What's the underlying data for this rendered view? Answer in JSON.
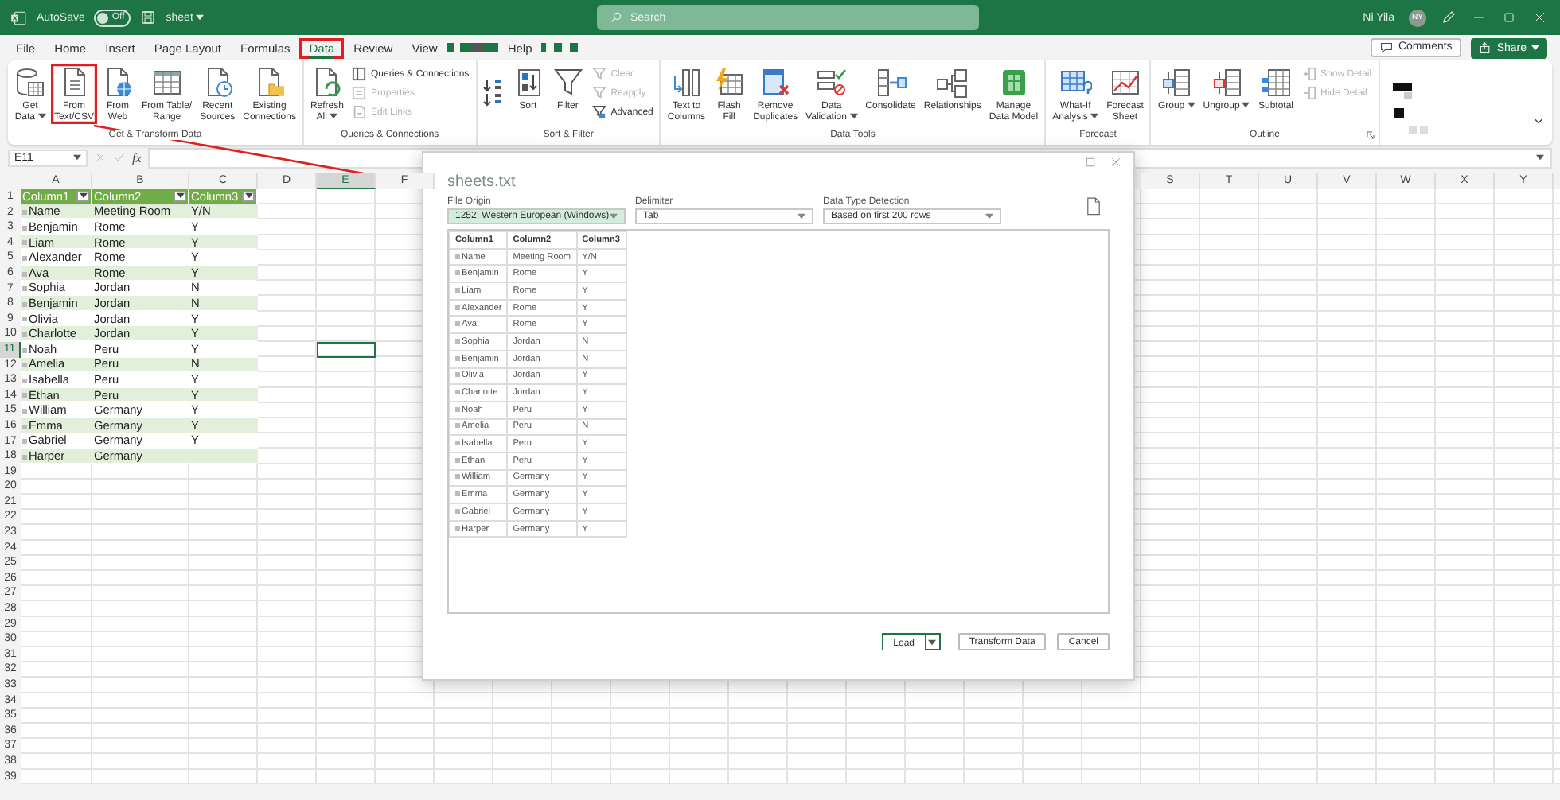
{
  "title_bar": {
    "autosave_label": "AutoSave",
    "autosave_on": false,
    "autosave_state": "Off",
    "file_name": "sheet",
    "search_placeholder": "Search",
    "user_name": "Ni Yila",
    "user_initials": "NY"
  },
  "menu_tabs": [
    {
      "label": "File",
      "selected": false,
      "highlighted": false
    },
    {
      "label": "Home",
      "selected": false,
      "highlighted": false
    },
    {
      "label": "Insert",
      "selected": false,
      "highlighted": false
    },
    {
      "label": "Page Layout",
      "selected": false,
      "highlighted": false
    },
    {
      "label": "Formulas",
      "selected": false,
      "highlighted": false
    },
    {
      "label": "Data",
      "selected": true,
      "highlighted": true
    },
    {
      "label": "Review",
      "selected": false,
      "highlighted": false
    },
    {
      "label": "View",
      "selected": false,
      "highlighted": false
    },
    {
      "label": "Help",
      "selected": false,
      "highlighted": false
    }
  ],
  "header_buttons": {
    "comments": "Comments",
    "share": "Share"
  },
  "ribbon": {
    "groups": [
      {
        "label": "Get & Transform Data",
        "items": [
          {
            "kind": "large",
            "lines": [
              "Get",
              "Data"
            ],
            "dropdown": true,
            "highlighted": false
          },
          {
            "kind": "large",
            "lines": [
              "From",
              "Text/CSV"
            ],
            "dropdown": false,
            "highlighted": true
          },
          {
            "kind": "large",
            "lines": [
              "From",
              "Web"
            ],
            "dropdown": false,
            "highlighted": false
          },
          {
            "kind": "large",
            "lines": [
              "From Table/",
              "Range"
            ],
            "dropdown": false,
            "highlighted": false
          },
          {
            "kind": "large",
            "lines": [
              "Recent",
              "Sources"
            ],
            "dropdown": false,
            "highlighted": false
          },
          {
            "kind": "large",
            "lines": [
              "Existing",
              "Connections"
            ],
            "dropdown": false,
            "highlighted": false
          }
        ]
      },
      {
        "label": "Queries & Connections",
        "items": [
          {
            "kind": "large",
            "lines": [
              "Refresh",
              "All"
            ],
            "dropdown": true,
            "highlighted": false
          },
          {
            "kind": "stack",
            "items": [
              {
                "label": "Queries & Connections",
                "disabled": false
              },
              {
                "label": "Properties",
                "disabled": true
              },
              {
                "label": "Edit Links",
                "disabled": true
              }
            ]
          }
        ]
      },
      {
        "label": "Sort & Filter",
        "items": [
          {
            "kind": "sort_pair"
          },
          {
            "kind": "large",
            "lines": [
              "Sort"
            ],
            "dropdown": false,
            "highlighted": false
          },
          {
            "kind": "large",
            "lines": [
              "Filter"
            ],
            "dropdown": false,
            "highlighted": false
          },
          {
            "kind": "stack",
            "items": [
              {
                "label": "Clear",
                "disabled": true
              },
              {
                "label": "Reapply",
                "disabled": true
              },
              {
                "label": "Advanced",
                "disabled": false
              }
            ]
          }
        ]
      },
      {
        "label": "Data Tools",
        "items": [
          {
            "kind": "large",
            "lines": [
              "Text to",
              "Columns"
            ],
            "dropdown": false,
            "highlighted": false
          },
          {
            "kind": "large",
            "lines": [
              "Flash",
              "Fill"
            ],
            "dropdown": false,
            "highlighted": false
          },
          {
            "kind": "large",
            "lines": [
              "Remove",
              "Duplicates"
            ],
            "dropdown": false,
            "highlighted": false
          },
          {
            "kind": "large",
            "lines": [
              "Data",
              "Validation"
            ],
            "dropdown": true,
            "highlighted": false
          },
          {
            "kind": "large",
            "lines": [
              "Consolidate"
            ],
            "dropdown": false,
            "highlighted": false
          },
          {
            "kind": "large",
            "lines": [
              "Relationships"
            ],
            "dropdown": false,
            "highlighted": false
          },
          {
            "kind": "large",
            "lines": [
              "Manage",
              "Data Model"
            ],
            "dropdown": false,
            "highlighted": false
          }
        ]
      },
      {
        "label": "Forecast",
        "items": [
          {
            "kind": "large",
            "lines": [
              "What-If",
              "Analysis"
            ],
            "dropdown": true,
            "highlighted": false
          },
          {
            "kind": "large",
            "lines": [
              "Forecast",
              "Sheet"
            ],
            "dropdown": false,
            "highlighted": false
          }
        ]
      },
      {
        "label": "Outline",
        "items": [
          {
            "kind": "large",
            "lines": [
              "Group"
            ],
            "dropdown": true,
            "highlighted": false
          },
          {
            "kind": "large",
            "lines": [
              "Ungroup"
            ],
            "dropdown": true,
            "highlighted": false
          },
          {
            "kind": "large",
            "lines": [
              "Subtotal"
            ],
            "dropdown": false,
            "highlighted": false
          },
          {
            "kind": "stack",
            "items": [
              {
                "label": "Show Detail",
                "disabled": true
              },
              {
                "label": "Hide Detail",
                "disabled": true
              }
            ]
          }
        ]
      }
    ]
  },
  "formula_bar": {
    "name_box": "E11",
    "function_label": "fx"
  },
  "sheet": {
    "columns": [
      {
        "label": "A",
        "selected": false
      },
      {
        "label": "B",
        "selected": false
      },
      {
        "label": "C",
        "selected": false
      },
      {
        "label": "D",
        "selected": false
      },
      {
        "label": "E",
        "selected": true
      },
      {
        "label": "F",
        "selected": false
      },
      {
        "label": "S",
        "selected": false
      },
      {
        "label": "T",
        "selected": false
      },
      {
        "label": "U",
        "selected": false
      },
      {
        "label": "V",
        "selected": false
      },
      {
        "label": "W",
        "selected": false
      },
      {
        "label": "X",
        "selected": false
      },
      {
        "label": "Y",
        "selected": false
      }
    ],
    "rows": [
      {
        "number": "1",
        "selected": false,
        "kind": "header",
        "cells": [
          "Column1",
          "Column2",
          "Column3"
        ]
      },
      {
        "number": "2",
        "selected": false,
        "kind": "band",
        "cells": [
          "Name",
          "Meeting Room",
          "Y/N"
        ]
      },
      {
        "number": "3",
        "selected": false,
        "kind": "plain",
        "cells": [
          "Benjamin",
          "Rome",
          "Y"
        ]
      },
      {
        "number": "4",
        "selected": false,
        "kind": "band",
        "cells": [
          "Liam",
          "Rome",
          "Y"
        ]
      },
      {
        "number": "5",
        "selected": false,
        "kind": "plain",
        "cells": [
          "Alexander",
          "Rome",
          "Y"
        ]
      },
      {
        "number": "6",
        "selected": false,
        "kind": "band",
        "cells": [
          "Ava",
          "Rome",
          "Y"
        ]
      },
      {
        "number": "7",
        "selected": false,
        "kind": "plain",
        "cells": [
          "Sophia",
          "Jordan",
          "N"
        ]
      },
      {
        "number": "8",
        "selected": false,
        "kind": "band",
        "cells": [
          "Benjamin",
          "Jordan",
          "N"
        ]
      },
      {
        "number": "9",
        "selected": false,
        "kind": "plain",
        "cells": [
          "Olivia",
          "Jordan",
          "Y"
        ]
      },
      {
        "number": "10",
        "selected": false,
        "kind": "band",
        "cells": [
          "Charlotte",
          "Jordan",
          "Y"
        ]
      },
      {
        "number": "11",
        "selected": true,
        "kind": "plain",
        "cells": [
          "Noah",
          "Peru",
          "Y"
        ]
      },
      {
        "number": "12",
        "selected": false,
        "kind": "band",
        "cells": [
          "Amelia",
          "Peru",
          "N"
        ]
      },
      {
        "number": "13",
        "selected": false,
        "kind": "plain",
        "cells": [
          "Isabella",
          "Peru",
          "Y"
        ]
      },
      {
        "number": "14",
        "selected": false,
        "kind": "band",
        "cells": [
          "Ethan",
          "Peru",
          "Y"
        ]
      },
      {
        "number": "15",
        "selected": false,
        "kind": "plain",
        "cells": [
          "William",
          "Germany",
          "Y"
        ]
      },
      {
        "number": "16",
        "selected": false,
        "kind": "band",
        "cells": [
          "Emma",
          "Germany",
          "Y"
        ]
      },
      {
        "number": "17",
        "selected": false,
        "kind": "plain",
        "cells": [
          "Gabriel",
          "Germany",
          "Y"
        ]
      },
      {
        "number": "18",
        "selected": false,
        "kind": "band",
        "cells": [
          "Harper",
          "Germany"
        ]
      },
      {
        "number": "19",
        "selected": false,
        "kind": "empty"
      },
      {
        "number": "20",
        "selected": false,
        "kind": "empty"
      },
      {
        "number": "21",
        "selected": false,
        "kind": "empty"
      },
      {
        "number": "22",
        "selected": false,
        "kind": "empty"
      },
      {
        "number": "23",
        "selected": false,
        "kind": "empty"
      },
      {
        "number": "24",
        "selected": false,
        "kind": "empty"
      },
      {
        "number": "25",
        "selected": false,
        "kind": "empty"
      },
      {
        "number": "26",
        "selected": false,
        "kind": "empty"
      },
      {
        "number": "27",
        "selected": false,
        "kind": "empty"
      },
      {
        "number": "28",
        "selected": false,
        "kind": "empty"
      },
      {
        "number": "29",
        "selected": false,
        "kind": "empty"
      },
      {
        "number": "30",
        "selected": false,
        "kind": "empty"
      },
      {
        "number": "31",
        "selected": false,
        "kind": "empty"
      },
      {
        "number": "32",
        "selected": false,
        "kind": "empty"
      },
      {
        "number": "33",
        "selected": false,
        "kind": "empty"
      },
      {
        "number": "34",
        "selected": false,
        "kind": "empty"
      },
      {
        "number": "35",
        "selected": false,
        "kind": "empty"
      },
      {
        "number": "36",
        "selected": false,
        "kind": "empty"
      },
      {
        "number": "37",
        "selected": false,
        "kind": "empty"
      },
      {
        "number": "38",
        "selected": false,
        "kind": "empty"
      },
      {
        "number": "39",
        "selected": false,
        "kind": "empty"
      }
    ]
  },
  "dialog": {
    "title": "sheets.txt",
    "fields": [
      {
        "label": "File Origin",
        "value": "1252: Western European (Windows)",
        "focused": true
      },
      {
        "label": "Delimiter",
        "value": "Tab",
        "focused": false
      },
      {
        "label": "Data Type Detection",
        "value": "Based on first 200 rows",
        "focused": false
      }
    ],
    "preview": {
      "columns": [
        "Column1",
        "Column2",
        "Column3"
      ],
      "rows": [
        [
          "Name",
          "Meeting Room",
          "Y/N"
        ],
        [
          "Benjamin",
          "Rome",
          "Y"
        ],
        [
          "Liam",
          "Rome",
          "Y"
        ],
        [
          "Alexander",
          "Rome",
          "Y"
        ],
        [
          "Ava",
          "Rome",
          "Y"
        ],
        [
          "Sophia",
          "Jordan",
          "N"
        ],
        [
          "Benjamin",
          "Jordan",
          "N"
        ],
        [
          "Olivia",
          "Jordan",
          "Y"
        ],
        [
          "Charlotte",
          "Jordan",
          "Y"
        ],
        [
          "Noah",
          "Peru",
          "Y"
        ],
        [
          "Amelia",
          "Peru",
          "N"
        ],
        [
          "Isabella",
          "Peru",
          "Y"
        ],
        [
          "Ethan",
          "Peru",
          "Y"
        ],
        [
          "William",
          "Germany",
          "Y"
        ],
        [
          "Emma",
          "Germany",
          "Y"
        ],
        [
          "Gabriel",
          "Germany",
          "Y"
        ],
        [
          "Harper",
          "Germany",
          "Y"
        ]
      ]
    },
    "buttons": [
      {
        "label": "Load",
        "kind": "split",
        "highlighted": true
      },
      {
        "label": "Transform Data",
        "kind": "plain",
        "highlighted": false
      },
      {
        "label": "Cancel",
        "kind": "plain",
        "highlighted": false
      }
    ]
  }
}
